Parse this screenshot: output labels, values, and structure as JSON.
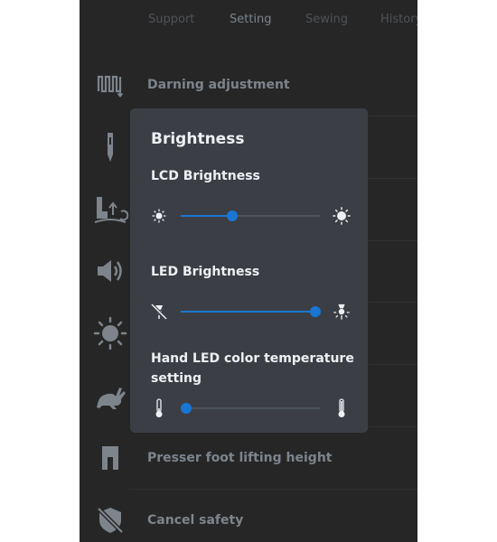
{
  "tabs": [
    {
      "label": "Support",
      "active": false
    },
    {
      "label": "Setting",
      "active": true
    },
    {
      "label": "Sewing",
      "active": false
    },
    {
      "label": "History",
      "active": false
    }
  ],
  "rows": [
    {
      "label": "Darning adjustment",
      "icon": "darning-icon"
    },
    {
      "label": "",
      "icon": "needle-icon"
    },
    {
      "label": "",
      "icon": "presser-foot-up-icon"
    },
    {
      "label": "",
      "icon": "speaker-icon"
    },
    {
      "label": "",
      "icon": "sun-icon"
    },
    {
      "label": "",
      "icon": "rabbit-icon"
    },
    {
      "label": "Presser foot lifting height",
      "icon": "presser-foot-icon"
    },
    {
      "label": "Cancel safety",
      "icon": "safety-off-icon"
    }
  ],
  "dialog": {
    "title": "Brightness",
    "lcd": {
      "label": "LCD Brightness",
      "value": 0.37,
      "min_icon": "sun-small-icon",
      "max_icon": "sun-large-icon"
    },
    "led": {
      "label": "LED Brightness",
      "value": 0.97,
      "min_icon": "light-off-icon",
      "max_icon": "light-on-icon"
    },
    "hand_led": {
      "label": "Hand LED color temperature setting",
      "value": 0.04,
      "min_icon": "thermometer-cold-icon",
      "max_icon": "thermometer-hot-icon"
    }
  },
  "colors": {
    "screen_bg": "#262626",
    "dialog_bg": "#3b3f45",
    "accent": "#1976d2",
    "muted_text": "#7d848c"
  }
}
